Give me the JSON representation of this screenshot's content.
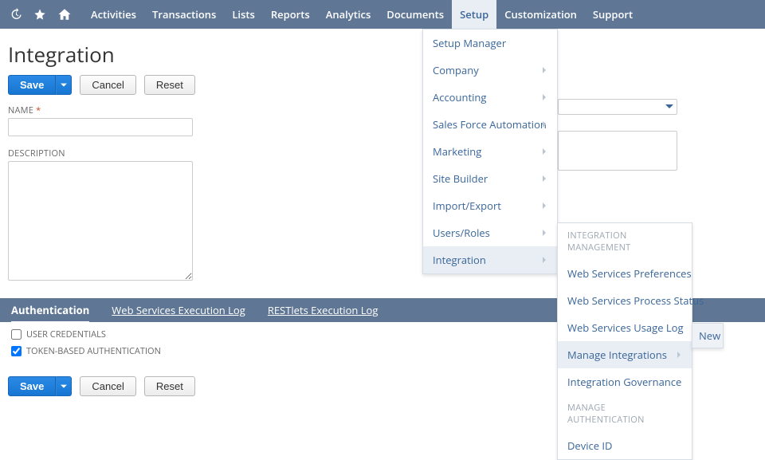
{
  "topnav": {
    "items": [
      "Activities",
      "Transactions",
      "Lists",
      "Reports",
      "Analytics",
      "Documents",
      "Setup",
      "Customization",
      "Support"
    ],
    "activeIndex": 6
  },
  "page": {
    "title": "Integration",
    "buttons": {
      "save": "Save",
      "cancel": "Cancel",
      "reset": "Reset"
    },
    "fields": {
      "nameLabel": "NAME",
      "reqMark": "*",
      "descLabel": "DESCRIPTION"
    },
    "subtabs": [
      "Authentication",
      "Web Services Execution Log",
      "RESTlets Execution Log"
    ],
    "checks": {
      "userCreds": "USER CREDENTIALS",
      "tokenAuth": "TOKEN-BASED AUTHENTICATION"
    }
  },
  "menus": {
    "setup": [
      {
        "label": "Setup Manager",
        "sub": false
      },
      {
        "label": "Company",
        "sub": true
      },
      {
        "label": "Accounting",
        "sub": true
      },
      {
        "label": "Sales Force Automation",
        "sub": true
      },
      {
        "label": "Marketing",
        "sub": true
      },
      {
        "label": "Site Builder",
        "sub": true
      },
      {
        "label": "Import/Export",
        "sub": true
      },
      {
        "label": "Users/Roles",
        "sub": true
      },
      {
        "label": "Integration",
        "sub": true,
        "hover": true
      }
    ],
    "integration": {
      "header1": "INTEGRATION MANAGEMENT",
      "items": [
        {
          "label": "Web Services Preferences"
        },
        {
          "label": "Web Services Process Status"
        },
        {
          "label": "Web Services Usage Log"
        },
        {
          "label": "Manage Integrations",
          "sub": true,
          "hover": true
        },
        {
          "label": "Integration Governance"
        }
      ],
      "header2": "MANAGE AUTHENTICATION",
      "items2": [
        {
          "label": "Device ID"
        }
      ]
    },
    "newItem": "New"
  }
}
